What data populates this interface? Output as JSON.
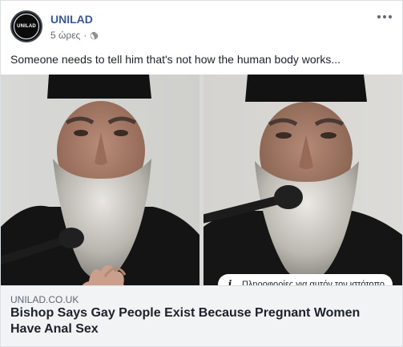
{
  "post": {
    "page_name": "UNILAD",
    "avatar_text": "UNILAD",
    "time": "5 ώρες",
    "separator": "·",
    "privacy_icon": "globe-icon",
    "more_icon": "more-horizontal-icon",
    "caption": "Someone needs to tell him that's not how the human body works..."
  },
  "media": {
    "frames": [
      {
        "name": "video-frame-left"
      },
      {
        "name": "video-frame-right"
      }
    ]
  },
  "link_info": {
    "icon": "info-icon",
    "label": "Πληροφορίες για αυτόν τον ιστότοπο"
  },
  "link_preview": {
    "domain": "UNILAD.CO.UK",
    "headline": "Bishop Says Gay People Exist Because Pregnant Women Have Anal Sex"
  }
}
